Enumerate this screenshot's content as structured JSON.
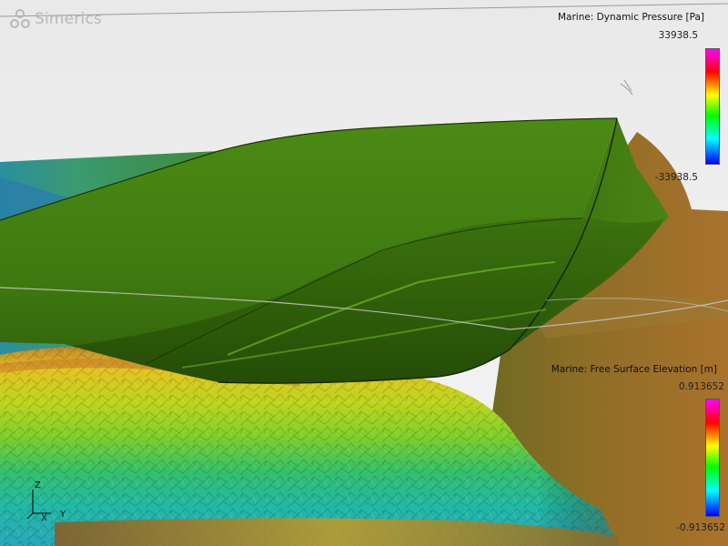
{
  "app": {
    "logo_text": "Simerics",
    "logo_icon": "simerics-logo-icon"
  },
  "legends": {
    "pressure": {
      "title": "Marine: Dynamic Pressure [Pa]",
      "max": "33938.5",
      "min": "-33938.5"
    },
    "surface": {
      "title": "Marine: Free Surface Elevation [m]",
      "max": "0.913652",
      "min": "-0.913652"
    }
  },
  "axes": {
    "z": "Z",
    "x": "X",
    "y": "Y"
  },
  "colors": {
    "background": "#eeeeee",
    "hull": "#3f7a10",
    "sea_low": "#1fb6a8",
    "sea_mid": "#9fd81c",
    "sea_high": "#e3cd22",
    "seabed": "#8a6a26"
  }
}
